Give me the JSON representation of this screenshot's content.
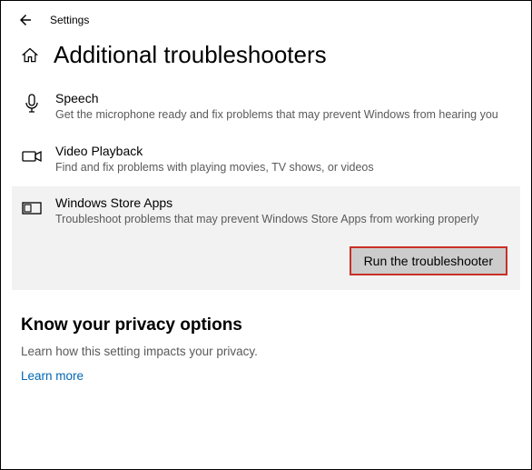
{
  "header": {
    "settings": "Settings"
  },
  "title": "Additional troubleshooters",
  "items": [
    {
      "title": "Speech",
      "desc": "Get the microphone ready and fix problems that may prevent Windows from hearing you"
    },
    {
      "title": "Video Playback",
      "desc": "Find and fix problems with playing movies, TV shows, or videos"
    },
    {
      "title": "Windows Store Apps",
      "desc": "Troubleshoot problems that may prevent Windows Store Apps from working properly"
    }
  ],
  "run_button": "Run the troubleshooter",
  "privacy": {
    "title": "Know your privacy options",
    "desc": "Learn how this setting impacts your privacy.",
    "link": "Learn more"
  }
}
